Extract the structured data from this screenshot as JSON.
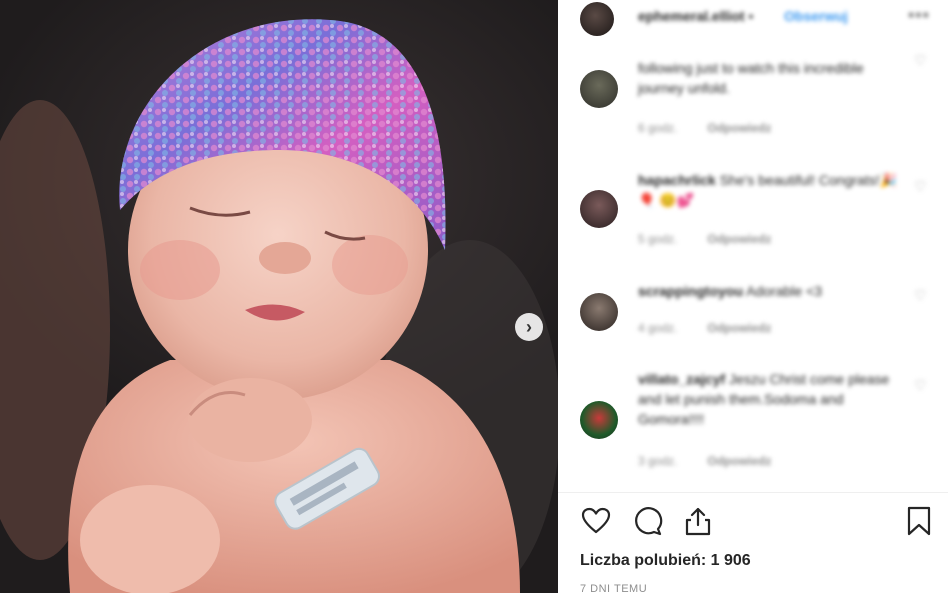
{
  "post": {
    "image": {
      "description_icon": "photo-icon"
    },
    "next_icon": "chevron-right-icon"
  },
  "header": {
    "username": "ephemeral.elliot",
    "separator": "•",
    "follow_label": "Obserwuj",
    "more_label": "•••"
  },
  "comments": [
    {
      "username": "",
      "text": "following just to watch this incredible journey unfold.",
      "time": "6 godz.",
      "reply": "Odpowiedz"
    },
    {
      "username": "hapachrlick",
      "text": "She's beautiful! Congrats!🎉🎈 😊💕",
      "time": "5 godz.",
      "reply": "Odpowiedz"
    },
    {
      "username": "scrappingtoyou",
      "text": "Adorable <3",
      "time": "4 godz.",
      "reply": "Odpowiedz"
    },
    {
      "username": "villato_zajcyf",
      "text": "Jeszu Christ come please and let punish them.Sodoma and Gomora!!!!",
      "time": "3 godz.",
      "reply": "Odpowiedz"
    }
  ],
  "actions": {
    "like_icon": "heart-icon",
    "comment_icon": "comment-icon",
    "share_icon": "share-icon",
    "save_icon": "bookmark-icon"
  },
  "likes_label": "Liczba polubień: 1 906",
  "timestamp": "7 DNI TEMU",
  "colors": {
    "link": "#3897f0",
    "text": "#262626",
    "muted": "#8e8e8e"
  }
}
